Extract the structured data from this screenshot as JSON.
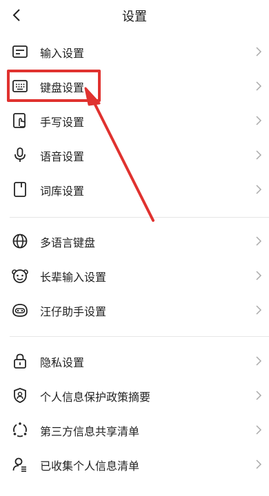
{
  "header": {
    "title": "设置",
    "back_icon": "chevron-left-icon"
  },
  "groups": [
    {
      "items": [
        {
          "label": "输入设置",
          "icon": "input-icon"
        },
        {
          "label": "键盘设置",
          "icon": "keyboard-icon"
        },
        {
          "label": "手写设置",
          "icon": "handwriting-icon"
        },
        {
          "label": "语音设置",
          "icon": "microphone-icon"
        },
        {
          "label": "词库设置",
          "icon": "dictionary-icon"
        }
      ]
    },
    {
      "items": [
        {
          "label": "多语言键盘",
          "icon": "globe-icon"
        },
        {
          "label": "长辈输入设置",
          "icon": "elder-icon"
        },
        {
          "label": "汪仔助手设置",
          "icon": "assistant-icon"
        }
      ]
    },
    {
      "items": [
        {
          "label": "隐私设置",
          "icon": "lock-icon"
        },
        {
          "label": "个人信息保护政策摘要",
          "icon": "shield-user-icon"
        },
        {
          "label": "第三方信息共享清单",
          "icon": "share-circle-icon"
        },
        {
          "label": "已收集个人信息清单",
          "icon": "user-list-icon"
        }
      ]
    }
  ],
  "annotation": {
    "highlighted_item": "键盘设置",
    "color": "#e0322f"
  }
}
